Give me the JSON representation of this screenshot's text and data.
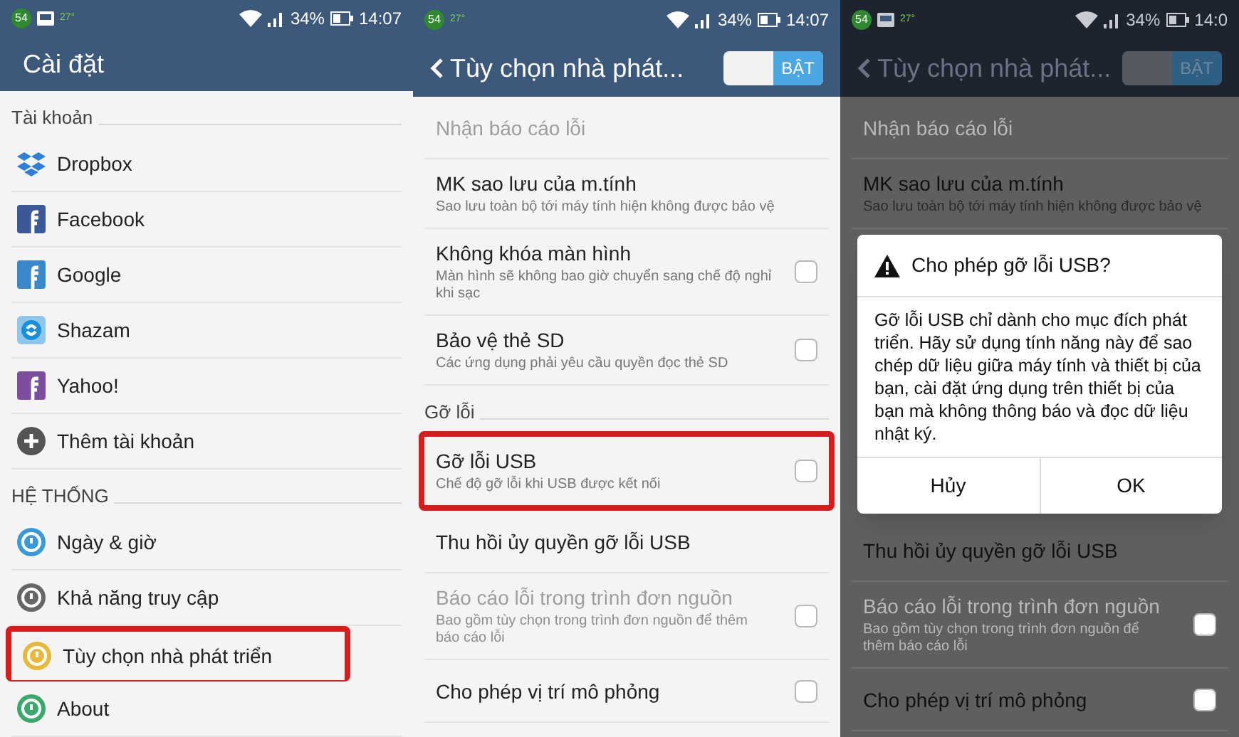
{
  "screens": [
    {
      "dimmed": false,
      "status_bar": {
        "badge": "54",
        "temp": "27°",
        "image_icon": true,
        "battery": "34%",
        "time": "14:07"
      },
      "header": {
        "title": "Cài đặt",
        "back": false
      },
      "items": [
        {
          "kind": "section",
          "label": "Tài khoản"
        },
        {
          "kind": "entry",
          "label": "Dropbox",
          "highlighted": false
        },
        {
          "kind": "entry",
          "label": "Facebook",
          "highlighted": false
        },
        {
          "kind": "entry",
          "label": "Google",
          "highlighted": false
        },
        {
          "kind": "entry",
          "label": "Shazam",
          "highlighted": false
        },
        {
          "kind": "entry",
          "label": "Yahoo!",
          "highlighted": false
        },
        {
          "kind": "entry",
          "label": "Thêm tài khoản",
          "highlighted": false
        },
        {
          "kind": "section",
          "label": "HỆ THỐNG"
        },
        {
          "kind": "entry",
          "label": "Ngày & giờ",
          "highlighted": false
        },
        {
          "kind": "entry",
          "label": "Khả năng truy cập",
          "highlighted": false
        },
        {
          "kind": "entry",
          "label": "Tùy chọn nhà phát triển",
          "highlighted": true
        },
        {
          "kind": "entry",
          "label": "About",
          "highlighted": false
        }
      ]
    },
    {
      "dimmed": false,
      "status_bar": {
        "badge": "54",
        "temp": "27°",
        "image_icon": false,
        "battery": "34%",
        "time": "14:07"
      },
      "header": {
        "title": "Tùy chọn nhà phát...",
        "back": true,
        "toggle": {
          "label": "BẬT",
          "on": true
        }
      },
      "items": [
        {
          "kind": "option",
          "label": "Nhận báo cáo lỗi",
          "disabled": true,
          "highlighted": false
        },
        {
          "kind": "option",
          "label": "MK sao lưu của m.tính",
          "subtitle": "Sao lưu toàn bộ tới máy tính hiện không được bảo vệ",
          "disabled": false,
          "highlighted": false
        },
        {
          "kind": "option",
          "label": "Không khóa màn hình",
          "subtitle": "Màn hình sẽ không bao giờ chuyển sang chế độ nghỉ khi sạc",
          "checked": false,
          "disabled": false,
          "highlighted": false
        },
        {
          "kind": "option",
          "label": "Bảo vệ thẻ SD",
          "subtitle": "Các ứng dụng phải yêu cầu quyền đọc thẻ SD",
          "checked": false,
          "disabled": false,
          "highlighted": false
        },
        {
          "kind": "section",
          "label": "Gỡ lỗi"
        },
        {
          "kind": "option",
          "label": "Gỡ lỗi USB",
          "subtitle": "Chế độ gỡ lỗi khi USB được kết nối",
          "checked": false,
          "disabled": false,
          "highlighted": true
        },
        {
          "kind": "option",
          "label": "Thu hồi ủy quyền gỡ lỗi USB",
          "disabled": false,
          "highlighted": false
        },
        {
          "kind": "option",
          "label": "Báo cáo lỗi trong trình đơn nguồn",
          "subtitle": "Bao gồm tùy chọn trong trình đơn nguồn để thêm báo cáo lỗi",
          "checked": false,
          "disabled": true,
          "highlighted": false
        },
        {
          "kind": "option",
          "label": "Cho phép vị trí mô phỏng",
          "checked": false,
          "disabled": false,
          "highlighted": false
        }
      ]
    },
    {
      "dimmed": true,
      "status_bar": {
        "badge": "54",
        "temp": "27°",
        "image_icon": true,
        "battery": "34%",
        "time": "14:0"
      },
      "header": {
        "title": "Tùy chọn nhà phát...",
        "back": true,
        "toggle": {
          "label": "BẬT",
          "on": true
        }
      },
      "items": [
        {
          "kind": "option",
          "label": "Nhận báo cáo lỗi",
          "disabled": true,
          "highlighted": false
        },
        {
          "kind": "option",
          "label": "MK sao lưu của m.tính",
          "subtitle": "Sao lưu toàn bộ tới máy tính hiện không được bảo vệ",
          "disabled": false,
          "highlighted": false
        },
        {
          "kind": "dialog",
          "title": "Cho phép gỡ lỗi USB?",
          "body": "Gỡ lỗi USB chỉ dành cho mục đích phát triển. Hãy sử dụng tính năng này để sao chép dữ liệu giữa máy tính và thiết bị của bạn, cài đặt ứng dụng trên thiết bị của bạn mà không thông báo và đọc dữ liệu nhật ký.",
          "buttons": [
            "Hủy",
            "OK"
          ]
        },
        {
          "kind": "option",
          "label": "Thu hồi ủy quyền gỡ lỗi USB",
          "disabled": false,
          "highlighted": false
        },
        {
          "kind": "option",
          "label": "Báo cáo lỗi trong trình đơn nguồn",
          "subtitle": "Bao gồm tùy chọn trong trình đơn nguồn để thêm báo cáo lỗi",
          "checked": false,
          "disabled": true,
          "highlighted": false
        },
        {
          "kind": "option",
          "label": "Cho phép vị trí mô phỏng",
          "checked": false,
          "disabled": false,
          "highlighted": false
        }
      ]
    }
  ]
}
